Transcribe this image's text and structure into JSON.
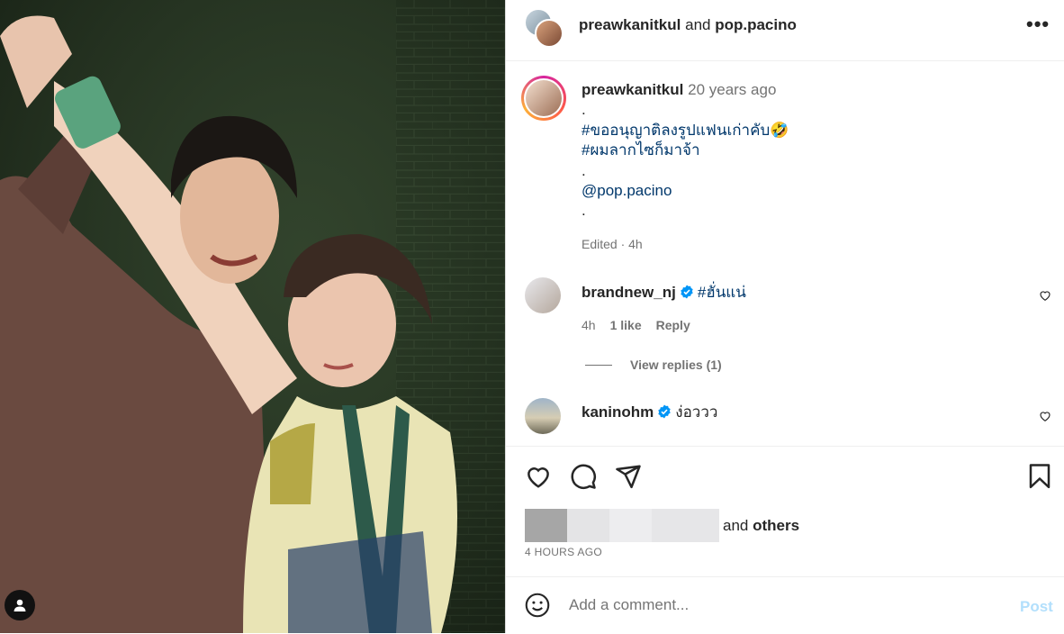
{
  "header": {
    "user1": "preawkanitkul",
    "and_word": "and",
    "user2": "pop.pacino",
    "more": "•••"
  },
  "caption": {
    "username": "preawkanitkul",
    "age": "20 years ago",
    "lines": [
      ".",
      "#ขออนุญาติลงรูปแฟนเก่าคับ🤣",
      "#ผมลากไซก็มาจ้า",
      ".",
      "@pop.pacino",
      "."
    ],
    "edited": "Edited · 4h"
  },
  "comments": [
    {
      "user": "brandnew_nj",
      "text": "#ฮั่นแน่",
      "time": "4h",
      "likes": "1 like",
      "reply": "Reply"
    },
    {
      "user": "kaninohm",
      "text": "ง่อววว",
      "time": "",
      "likes": "",
      "reply": ""
    }
  ],
  "view_replies": "View replies (1)",
  "likes": {
    "and_text": "and",
    "others": "others"
  },
  "timestamp": "4 HOURS AGO",
  "comment_input": {
    "placeholder": "Add a comment..."
  },
  "post_button": "Post",
  "icons": [
    "heart-icon",
    "comment-icon",
    "share-icon",
    "bookmark-icon",
    "emoji-icon",
    "person-icon",
    "verified-icon",
    "more-icon"
  ],
  "colors": {
    "link": "#00376b",
    "muted": "#737373",
    "verified": "#0095f6",
    "post_disabled": "#b2dffc"
  }
}
